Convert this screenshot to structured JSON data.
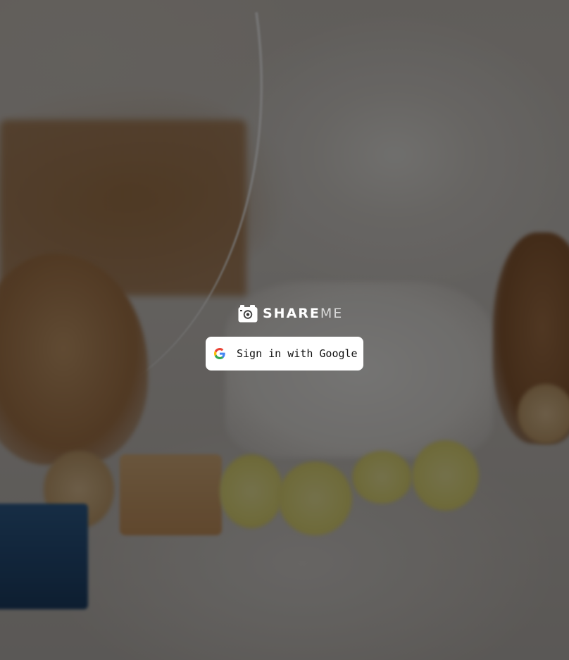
{
  "app": {
    "logo": {
      "text_main": "SHARE",
      "text_accent": "ME",
      "icon": "camera-icon"
    }
  },
  "login": {
    "google_button_label": "Sign in with Google",
    "google_icon": "google-icon"
  },
  "colors": {
    "overlay": "#000000",
    "button_bg": "#ffffff",
    "button_text": "#111111"
  }
}
